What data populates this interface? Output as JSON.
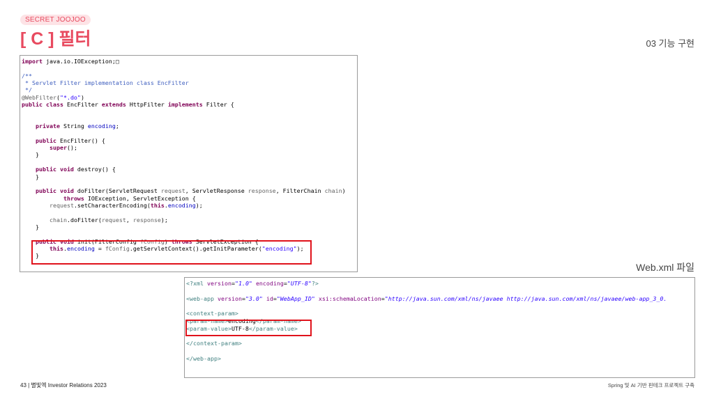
{
  "header": {
    "badge": "SECRET JOOJOO",
    "title": "[ C ] 필터",
    "section": "03 기능 구현"
  },
  "web_xml_label": "Web.xml 파일",
  "java_code": {
    "lines": [
      [
        {
          "t": "import",
          "c": "kw"
        },
        {
          "t": " java.io.IOException;□",
          "c": ""
        }
      ],
      [],
      [
        {
          "t": "/**",
          "c": "cm"
        }
      ],
      [
        {
          "t": " * Servlet Filter implementation class EncFilter",
          "c": "cm"
        }
      ],
      [
        {
          "t": " */",
          "c": "cm"
        }
      ],
      [
        {
          "t": "@WebFilter",
          "c": "ann"
        },
        {
          "t": "(",
          "c": ""
        },
        {
          "t": "\"*.do\"",
          "c": "str"
        },
        {
          "t": ")",
          "c": ""
        }
      ],
      [
        {
          "t": "public class",
          "c": "kw"
        },
        {
          "t": " EncFilter ",
          "c": ""
        },
        {
          "t": "extends",
          "c": "kw"
        },
        {
          "t": " HttpFilter ",
          "c": ""
        },
        {
          "t": "implements",
          "c": "kw"
        },
        {
          "t": " Filter {",
          "c": ""
        }
      ],
      [],
      [],
      [
        {
          "t": "    ",
          "c": ""
        },
        {
          "t": "private",
          "c": "kw"
        },
        {
          "t": " String ",
          "c": ""
        },
        {
          "t": "encoding",
          "c": "fld"
        },
        {
          "t": ";",
          "c": ""
        }
      ],
      [],
      [
        {
          "t": "    ",
          "c": ""
        },
        {
          "t": "public",
          "c": "kw"
        },
        {
          "t": " EncFilter() {",
          "c": ""
        }
      ],
      [
        {
          "t": "        ",
          "c": ""
        },
        {
          "t": "super",
          "c": "kw"
        },
        {
          "t": "();",
          "c": ""
        }
      ],
      [
        {
          "t": "    }",
          "c": ""
        }
      ],
      [],
      [
        {
          "t": "    ",
          "c": ""
        },
        {
          "t": "public void",
          "c": "kw"
        },
        {
          "t": " destroy() {",
          "c": ""
        }
      ],
      [
        {
          "t": "    }",
          "c": ""
        }
      ],
      [],
      [
        {
          "t": "    ",
          "c": ""
        },
        {
          "t": "public void",
          "c": "kw"
        },
        {
          "t": " doFilter(ServletRequest ",
          "c": ""
        },
        {
          "t": "request",
          "c": "ann"
        },
        {
          "t": ", ServletResponse ",
          "c": ""
        },
        {
          "t": "response",
          "c": "ann"
        },
        {
          "t": ", FilterChain ",
          "c": ""
        },
        {
          "t": "chain",
          "c": "ann"
        },
        {
          "t": ")",
          "c": ""
        }
      ],
      [
        {
          "t": "            ",
          "c": ""
        },
        {
          "t": "throws",
          "c": "kw"
        },
        {
          "t": " IOException, ServletException {",
          "c": ""
        }
      ],
      [
        {
          "t": "        ",
          "c": ""
        },
        {
          "t": "request",
          "c": "ann"
        },
        {
          "t": ".setCharacterEncoding(",
          "c": ""
        },
        {
          "t": "this",
          "c": "kw"
        },
        {
          "t": ".",
          "c": ""
        },
        {
          "t": "encoding",
          "c": "fld"
        },
        {
          "t": ");",
          "c": ""
        }
      ],
      [],
      [
        {
          "t": "        ",
          "c": ""
        },
        {
          "t": "chain",
          "c": "ann"
        },
        {
          "t": ".doFilter(",
          "c": ""
        },
        {
          "t": "request",
          "c": "ann"
        },
        {
          "t": ", ",
          "c": ""
        },
        {
          "t": "response",
          "c": "ann"
        },
        {
          "t": ");",
          "c": ""
        }
      ],
      [
        {
          "t": "    }",
          "c": ""
        }
      ],
      [],
      [
        {
          "t": "    ",
          "c": ""
        },
        {
          "t": "public void",
          "c": "kw"
        },
        {
          "t": " init(FilterConfig ",
          "c": ""
        },
        {
          "t": "fConfig",
          "c": "ann"
        },
        {
          "t": ") ",
          "c": ""
        },
        {
          "t": "throws",
          "c": "kw"
        },
        {
          "t": " ServletException {",
          "c": ""
        }
      ],
      [
        {
          "t": "        ",
          "c": ""
        },
        {
          "t": "this",
          "c": "kw"
        },
        {
          "t": ".",
          "c": ""
        },
        {
          "t": "encoding",
          "c": "fld"
        },
        {
          "t": " = ",
          "c": ""
        },
        {
          "t": "fConfig",
          "c": "ann"
        },
        {
          "t": ".getServletContext().getInitParameter(",
          "c": ""
        },
        {
          "t": "\"encoding\"",
          "c": "str"
        },
        {
          "t": ");",
          "c": ""
        }
      ],
      [
        {
          "t": "    }",
          "c": ""
        }
      ]
    ]
  },
  "xml_code": {
    "lines": [
      [
        {
          "t": "<?xml ",
          "c": "tag"
        },
        {
          "t": "version",
          "c": "attr"
        },
        {
          "t": "=",
          "c": ""
        },
        {
          "t": "\"1.0\"",
          "c": "aval"
        },
        {
          "t": " ",
          "c": ""
        },
        {
          "t": "encoding",
          "c": "attr"
        },
        {
          "t": "=",
          "c": ""
        },
        {
          "t": "\"UTF-8\"",
          "c": "aval"
        },
        {
          "t": "?>",
          "c": "tag"
        }
      ],
      [],
      [
        {
          "t": "<web-app ",
          "c": "tag"
        },
        {
          "t": "version",
          "c": "attr"
        },
        {
          "t": "=",
          "c": ""
        },
        {
          "t": "\"3.0\"",
          "c": "aval"
        },
        {
          "t": " ",
          "c": ""
        },
        {
          "t": "id",
          "c": "attr"
        },
        {
          "t": "=",
          "c": ""
        },
        {
          "t": "\"WebApp_ID\"",
          "c": "aval"
        },
        {
          "t": " ",
          "c": ""
        },
        {
          "t": "xsi:schemaLocation",
          "c": "attr"
        },
        {
          "t": "=",
          "c": ""
        },
        {
          "t": "\"http://java.sun.com/xml/ns/javaee http://java.sun.com/xml/ns/javaee/web-app_3_0.",
          "c": "aval"
        }
      ],
      [],
      [
        {
          "t": "<context-param>",
          "c": "tag"
        }
      ],
      [
        {
          "t": "<param-name>",
          "c": "tag"
        },
        {
          "t": "encoding",
          "c": ""
        },
        {
          "t": "</param-name>",
          "c": "tag"
        }
      ],
      [
        {
          "t": "<param-value>",
          "c": "tag"
        },
        {
          "t": "UTF-8",
          "c": ""
        },
        {
          "t": "</param-value>",
          "c": "tag"
        }
      ],
      [],
      [
        {
          "t": "</context-param>",
          "c": "tag"
        }
      ],
      [],
      [
        {
          "t": "</web-app>",
          "c": "tag"
        }
      ]
    ]
  },
  "footer": {
    "left": "43  |  별빛엑 Investor Relations 2023",
    "right": "Spring 및 AI 기반 핀테크 프로젝트 구축"
  },
  "colors": {
    "accent": "#e84a5f",
    "highlight_box": "#e0121b"
  }
}
